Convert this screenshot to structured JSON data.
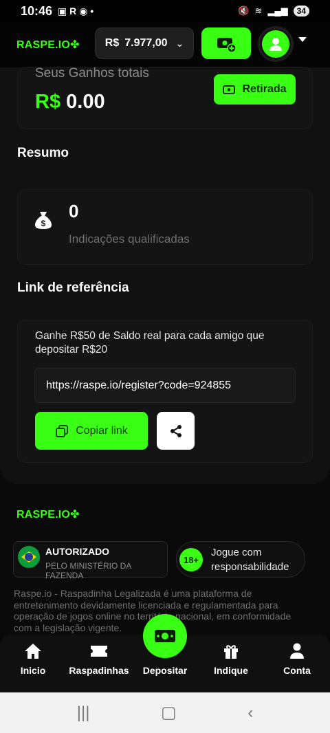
{
  "status": {
    "time": "10:46",
    "battery": "34"
  },
  "header": {
    "logo_text": "RASPE.IO",
    "balance_currency": "R$",
    "balance_value": "7.977,00"
  },
  "earnings": {
    "label": "Seus Ganhos totais",
    "currency": "R$",
    "value": "0.00",
    "withdraw_label": "Retirada"
  },
  "summary": {
    "title": "Resumo",
    "count": "0",
    "subtitle": "Indicações qualificadas"
  },
  "referral": {
    "title": "Link de referência",
    "description": "Ganhe R$50 de Saldo real para cada amigo que depositar R$20",
    "link": "https://raspe.io/register?code=924855",
    "copy_label": "Copiar link"
  },
  "footer": {
    "logo_text": "RASPE.IO",
    "auth_title": "AUTORIZADO",
    "auth_sub": "PELO MINISTÉRIO DA FAZENDA",
    "age_badge": "18+",
    "age_text": "Jogue com responsabilidade",
    "disclaimer": "Raspe.io - Raspadinha Legalizada é uma plataforma de entretenimento devidamente licenciada e regulamentada para operação de jogos online no território nacional, em conformidade com a legislação vigente."
  },
  "nav": {
    "items": [
      {
        "label": "Inicio",
        "icon": "home-icon"
      },
      {
        "label": "Raspadinhas",
        "icon": "ticket-icon"
      },
      {
        "label": "Depositar",
        "icon": "cash-icon"
      },
      {
        "label": "Indique",
        "icon": "gift-icon"
      },
      {
        "label": "Conta",
        "icon": "user-icon"
      }
    ]
  },
  "colors": {
    "accent": "#39ff14",
    "background": "#0a0a0a"
  }
}
